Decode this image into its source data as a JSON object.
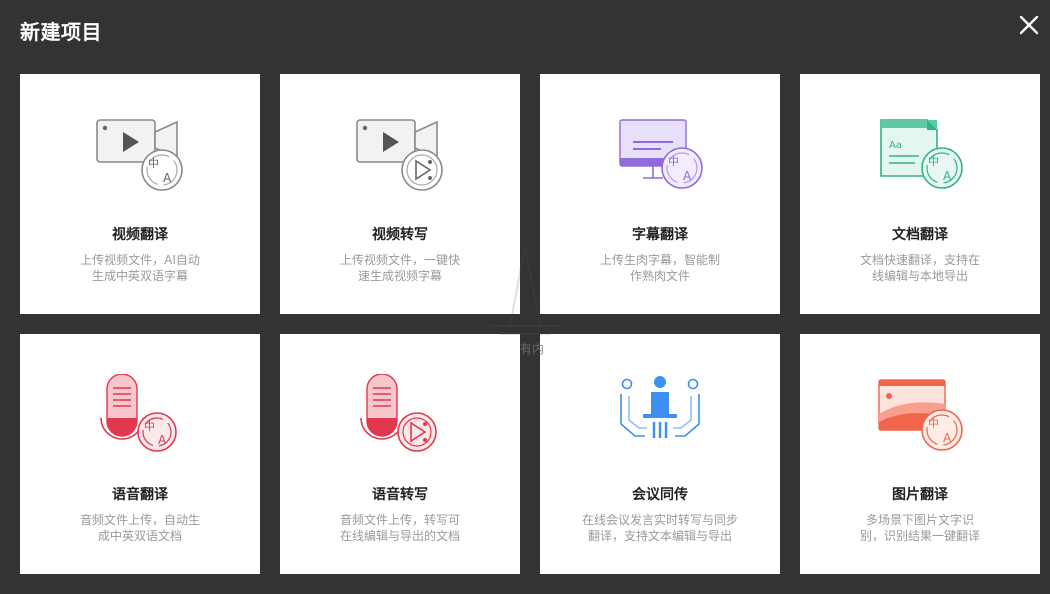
{
  "dialog": {
    "title": "新建项目",
    "close_icon": "close-icon"
  },
  "cards": [
    {
      "id": "video-translate",
      "name": "视频翻译",
      "desc_line1": "上传视频文件，AI自动",
      "desc_line2": "生成中英双语字幕",
      "icon": "video-translate-icon"
    },
    {
      "id": "video-transcribe",
      "name": "视频转写",
      "desc_line1": "上传视频文件，一键快",
      "desc_line2": "速生成视频字幕",
      "icon": "video-transcribe-icon"
    },
    {
      "id": "subtitle-translate",
      "name": "字幕翻译",
      "desc_line1": "上传生肉字幕，智能制",
      "desc_line2": "作熟肉文件",
      "icon": "subtitle-translate-icon"
    },
    {
      "id": "document-translate",
      "name": "文档翻译",
      "desc_line1": "文档快速翻译，支持在",
      "desc_line2": "线编辑与本地导出",
      "icon": "document-translate-icon"
    },
    {
      "id": "audio-translate",
      "name": "语音翻译",
      "desc_line1": "音频文件上传，自动生",
      "desc_line2": "成中英双语文档",
      "icon": "audio-translate-icon"
    },
    {
      "id": "audio-transcribe",
      "name": "语音转写",
      "desc_line1": "音频文件上传，转写可",
      "desc_line2": "在线编辑与导出的文档",
      "icon": "audio-transcribe-icon"
    },
    {
      "id": "meeting-interpret",
      "name": "会议同传",
      "desc_line1": "在线会议发言实时转写与同步",
      "desc_line2": "翻译，支持文本编辑与导出",
      "icon": "meeting-interpret-icon"
    },
    {
      "id": "image-translate",
      "name": "图片翻译",
      "desc_line1": "多场景下图片文字识",
      "desc_line2": "别，识别结果一键翻译",
      "icon": "image-translate-icon"
    }
  ],
  "watermark": {
    "text": "有内"
  },
  "colors": {
    "background": "#333333",
    "card": "#ffffff",
    "gray_icon": "#8a8a8a",
    "purple": "#8f6bdb",
    "green": "#2fb38a",
    "red": "#e0394e",
    "blue": "#3d8ff0",
    "orange": "#f2654d"
  }
}
